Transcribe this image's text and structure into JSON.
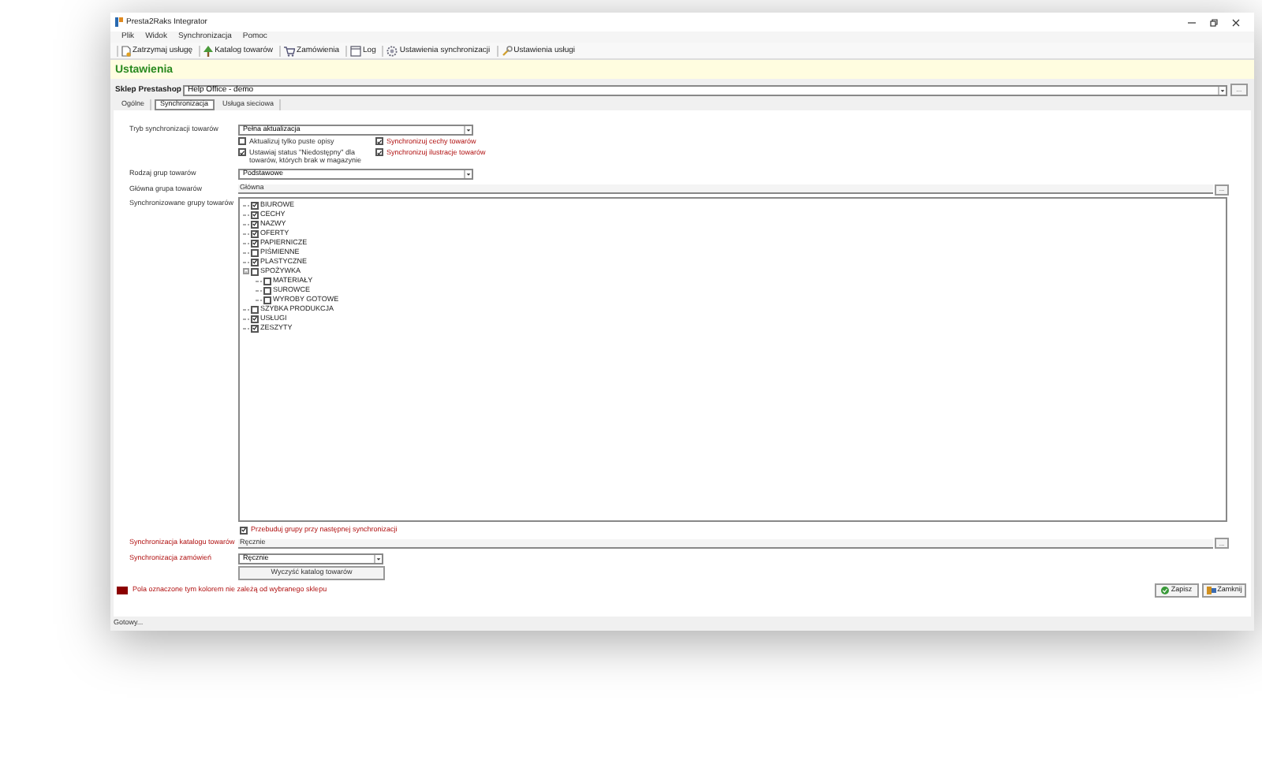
{
  "window": {
    "title": "Presta2Raks Integrator"
  },
  "menu": [
    "Plik",
    "Widok",
    "Synchronizacja",
    "Pomoc"
  ],
  "toolbar": [
    "Zatrzymaj usługę",
    "Katalog towarów",
    "Zamówienia",
    "Log",
    "Ustawienia synchronizacji",
    "Ustawienia usługi"
  ],
  "header": "Ustawienia",
  "shop": {
    "label": "Sklep Prestashop",
    "value": "Help Office - demo",
    "button": "..."
  },
  "tabs": [
    {
      "label": "Ogólne",
      "selected": false
    },
    {
      "label": "Synchronizacja",
      "selected": true
    },
    {
      "label": "Usługa sieciowa",
      "selected": false
    }
  ],
  "sync_mode": {
    "label": "Tryb synchronizacji towarów",
    "value": "Pełna aktualizacja"
  },
  "options": [
    {
      "label": "Aktualizuj tylko puste opisy",
      "checked": false,
      "dependent": false
    },
    {
      "label": "Synchronizuj cechy towarów",
      "checked": true,
      "dependent": true
    },
    {
      "label": "Ustawiaj status \"Niedostępny\" dla towarów, których brak w magazynie",
      "checked": true,
      "dependent": false
    },
    {
      "label": "Synchronizuj ilustracje towarów",
      "checked": true,
      "dependent": true
    }
  ],
  "group_type": {
    "label": "Rodzaj grup towarów",
    "value": "Podstawowe"
  },
  "main_group": {
    "label": "Główna grupa towarów",
    "value": "Główna",
    "button": "..."
  },
  "groups": {
    "label": "Synchronizowane grupy towarów",
    "items": [
      {
        "label": "BIUROWE",
        "checked": true
      },
      {
        "label": "CECHY",
        "checked": true
      },
      {
        "label": "NAZWY",
        "checked": true
      },
      {
        "label": "OFERTY",
        "checked": true
      },
      {
        "label": "PAPIERNICZE",
        "checked": true
      },
      {
        "label": "PIŚMIENNE",
        "checked": false
      },
      {
        "label": "PLASTYCZNE",
        "checked": true
      },
      {
        "label": "SPOŻYWKA",
        "checked": false,
        "expanded": true,
        "children": [
          {
            "label": "MATERIAŁY",
            "checked": false
          },
          {
            "label": "SUROWCE",
            "checked": false
          },
          {
            "label": "WYROBY GOTOWE",
            "checked": false
          }
        ]
      },
      {
        "label": "SZYBKA PRODUKCJA",
        "checked": false
      },
      {
        "label": "USŁUGI",
        "checked": true
      },
      {
        "label": "ZESZYTY",
        "checked": true
      }
    ]
  },
  "rebuild": {
    "label": "Przebuduj grupy przy następnej synchronizacji",
    "checked": true,
    "dependent": true
  },
  "catalog_sync": {
    "label": "Synchronizacja katalogu towarów",
    "value": "Ręcznie",
    "button": "...",
    "dependent": true
  },
  "order_sync": {
    "label": "Synchronizacja zamówień",
    "value": "Ręcznie",
    "dependent": true
  },
  "clear_button": "Wyczyść katalog towarów",
  "legend": "Pola oznaczone tym kolorem nie zależą od wybranego sklepu",
  "buttons": [
    "Zapisz",
    "Zamknij"
  ],
  "status_bar": "Gotowy..."
}
